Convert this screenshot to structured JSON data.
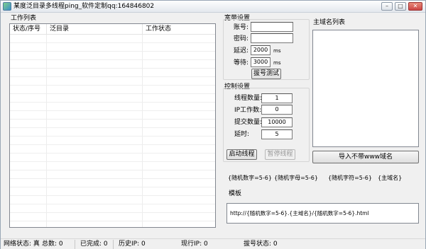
{
  "window": {
    "title": "某度泛目录多线程ping_软件定制qq:164846802",
    "min_glyph": "–",
    "max_glyph": "□",
    "close_glyph": "✕"
  },
  "work_list": {
    "label": "工作列表",
    "columns": [
      "状态/序号",
      "泛目录",
      "工作状态"
    ]
  },
  "broadband": {
    "label": "宽带设置",
    "account_label": "账号:",
    "account_value": "",
    "password_label": "密码:",
    "password_value": "",
    "delay_label": "延迟:",
    "delay_value": "2000",
    "delay_unit": "ms",
    "wait_label": "等待:",
    "wait_value": "3000",
    "wait_unit": "ms",
    "test_button": "拔号测试"
  },
  "control": {
    "label": "控制设置",
    "threads_label": "线程数量:",
    "threads_value": "1",
    "ip_jobs_label": "IP工作数:",
    "ip_jobs_value": "0",
    "submit_label": "提交数量:",
    "submit_value": "10000",
    "timeout_label": "延时:",
    "timeout_value": "5",
    "start_button": "启动线程",
    "pause_button": "暂停线程"
  },
  "domains": {
    "label": "主域名列表",
    "import_button": "导入不带www域名"
  },
  "macros": {
    "random_digits": "{随机数字=5-6}",
    "random_letters": "{随机字母=5-6}",
    "random_chars": "{随机字符=5-6}",
    "main_domain": "{主域名}"
  },
  "template": {
    "label": "模板",
    "value": "http://{随机数字=5-6}.{主域名}/{随机数字=5-6}.html"
  },
  "status_bar": {
    "network": "网络状态: 真",
    "total": "总数: 0",
    "done": "已完成: 0",
    "history_ip": "历史IP: 0",
    "current_ip": "现行IP: 0",
    "dial_status": "拔号状态: 0"
  }
}
